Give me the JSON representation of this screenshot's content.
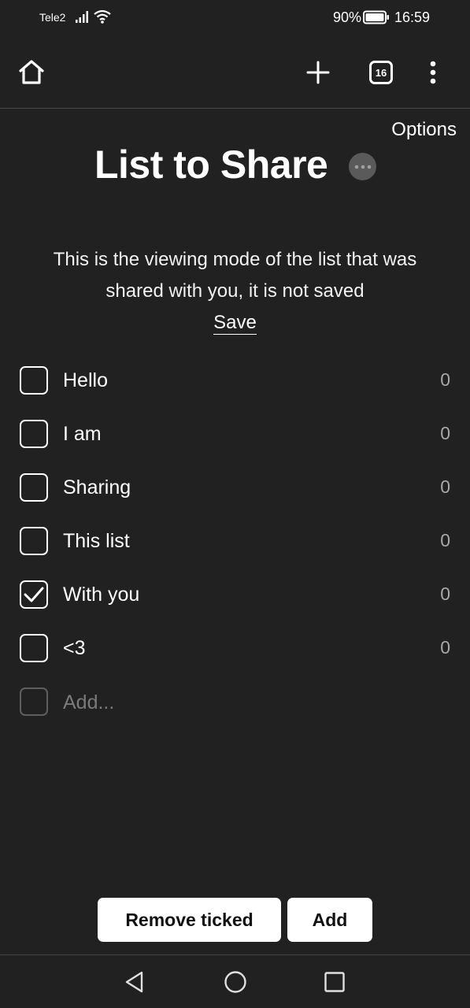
{
  "status_bar": {
    "carrier": "Tele2",
    "battery": "90%",
    "time": "16:59",
    "icons": [
      "signal-icon",
      "wifi-icon",
      "battery-icon"
    ]
  },
  "browser_toolbar": {
    "tab_count": "16",
    "icons": [
      "home-icon",
      "plus-icon",
      "tabs-icon",
      "more-vertical-icon"
    ]
  },
  "page": {
    "options_label": "Options",
    "title": "List to Share",
    "info_line1": "This is the viewing mode of the list that was",
    "info_line2": "shared with you, it is not saved",
    "save_label": "Save"
  },
  "list": {
    "items": [
      {
        "label": "Hello",
        "count": "0",
        "checked": false
      },
      {
        "label": "I am",
        "count": "0",
        "checked": false
      },
      {
        "label": "Sharing",
        "count": "0",
        "checked": false
      },
      {
        "label": "This list",
        "count": "0",
        "checked": false
      },
      {
        "label": "With you",
        "count": "0",
        "checked": true
      },
      {
        "label": "<3",
        "count": "0",
        "checked": false
      }
    ],
    "add_placeholder": "Add..."
  },
  "actions": {
    "remove_ticked_label": "Remove ticked",
    "add_label": "Add"
  },
  "nav_bar": {
    "icons": [
      "back-triangle-icon",
      "home-circle-icon",
      "recent-apps-icon"
    ]
  },
  "colors": {
    "background": "#212121",
    "text": "#ffffff",
    "muted": "#a8a8a8",
    "button_bg": "#ffffff"
  }
}
